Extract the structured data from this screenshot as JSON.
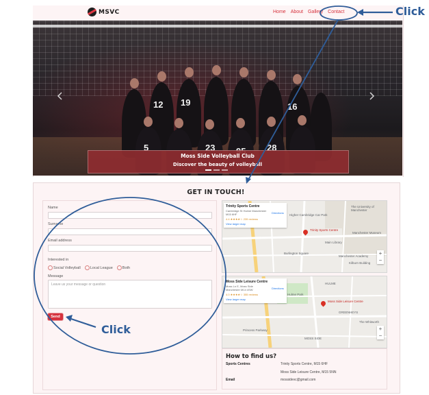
{
  "nav": {
    "logo_text": "MSVC",
    "links": [
      "Home",
      "About",
      "Gallery",
      "Contact"
    ]
  },
  "hero": {
    "title": "Moss Side Volleyball Club",
    "subtitle": "Discover the beauty of volleyball",
    "prev_icon": "chevron-left-icon",
    "next_icon": "chevron-right-icon",
    "jersey_numbers": [
      "12",
      "19",
      "16",
      "5",
      "23",
      "95",
      "28"
    ]
  },
  "annotations": {
    "top_click": "Click",
    "bottom_click": "Click",
    "annotation_color": "#2f5d99"
  },
  "contact": {
    "heading": "GET IN TOUCH!",
    "name_label": "Name",
    "surname_label": "Surname",
    "email_label": "Email address",
    "interest_label": "Interested in",
    "options": [
      "Social Volleyball",
      "Local League",
      "Both"
    ],
    "message_label": "Message",
    "message_placeholder": "Leave us your message or question",
    "send_label": "Send"
  },
  "maps": {
    "map1": {
      "place": "Trinity Sports Centre",
      "address": "Cambridge St Hulme Manchester M15 6HF",
      "rating": "4.4 ★★★★☆ 239 reviews",
      "larger": "View larger map",
      "directions": "Directions",
      "pin_label": "Trinity Sports Centre",
      "labels": [
        "The University of Manchester",
        "Higher Cambridge Car Park",
        "Manchester Museum",
        "Main Library",
        "Burlington Square",
        "Whitworth Art Gallery",
        "Manchester Academy",
        "Kilburn Building"
      ]
    },
    "map2": {
      "place": "Moss Side Leisure Centre",
      "address": "Moss Ln E, Moss Side Manchester M14 4SW",
      "rating": "4.0 ★★★★☆ 355 reviews",
      "larger": "View larger map",
      "directions": "Directions",
      "pin_label": "Moss Side Leisure Centre",
      "labels": [
        "HULME",
        "GREENHEYS",
        "MOSS SIDE",
        "Hulme Park",
        "The Whitworth",
        "Princess Parkway"
      ]
    }
  },
  "find_us": {
    "title": "How to find us?",
    "sports_label": "Sports Centres",
    "sports_values": [
      "Trinity Sports Centre, M15 6HF",
      "Moss Side Leisure Centre, M15 5NN"
    ],
    "email_label": "Email",
    "email_value": "mossidevc@gmail.com"
  }
}
